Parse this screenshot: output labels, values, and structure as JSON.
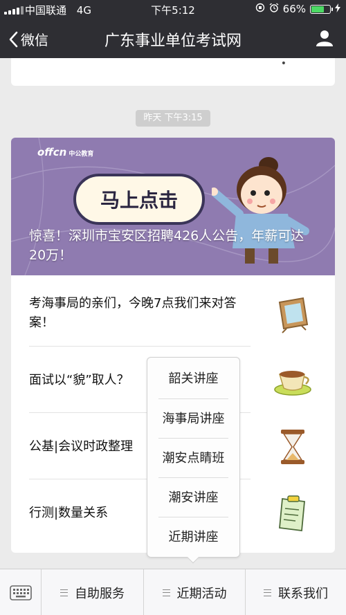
{
  "status_bar": {
    "carrier": "中国联通",
    "network": "4G",
    "time": "下午5:12",
    "battery": "66%"
  },
  "nav": {
    "back_label": "微信",
    "title": "广东事业单位考试网"
  },
  "timestamp": "昨天 下午3:15",
  "banner": {
    "logo_text": "offcn",
    "logo_sub": "中公教育",
    "cta": "马上点击",
    "headline": "惊喜！深圳市宝安区招聘426人公告，年薪可达20万！"
  },
  "articles": [
    {
      "title": "考海事局的亲们，今晚7点我们来对答案！",
      "icon": "picture-frame-icon"
    },
    {
      "title": "面试以“貌”取人？",
      "icon": "coffee-cup-icon"
    },
    {
      "title": "公基|会议时政整理",
      "icon": "hourglass-icon"
    },
    {
      "title": "行测|数量关系",
      "icon": "clipboard-icon"
    }
  ],
  "popup_menu": [
    "韶关讲座",
    "海事局讲座",
    "潮安点睛班",
    "潮安讲座",
    "近期讲座"
  ],
  "bottom_tabs": [
    "自助服务",
    "近期活动",
    "联系我们"
  ],
  "colors": {
    "nav_bg": "#2e2e33",
    "banner_bg": "#8f7bb0",
    "battery_fill": "#4cd964"
  }
}
